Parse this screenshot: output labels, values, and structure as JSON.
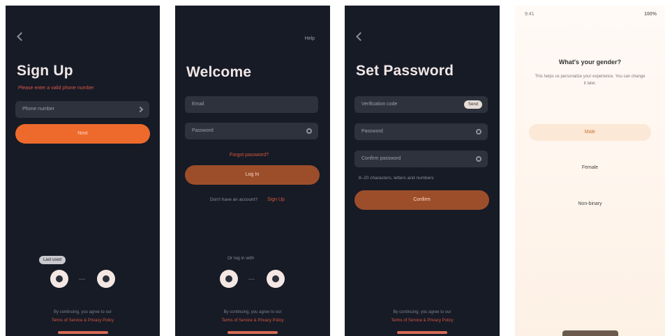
{
  "signup": {
    "title": "Sign Up",
    "error": "Please enter a valid phone number",
    "phone_placeholder": "Phone number",
    "button": "Next",
    "tooltip": "Last used",
    "footer_text": "By continuing, you agree to our",
    "footer_links": "Terms of Service & Privacy Policy"
  },
  "welcome": {
    "top_right": "Help",
    "title": "Welcome",
    "email_placeholder": "Email",
    "password_placeholder": "Password",
    "forgot": "Forgot password?",
    "button": "Log In",
    "signup_prompt": "Don't have an account?",
    "signup_link": "Sign Up",
    "alt_login": "Or log in with",
    "footer_text": "By continuing, you agree to our",
    "footer_links": "Terms of Service & Privacy Policy"
  },
  "setpassword": {
    "title": "Set Password",
    "code_placeholder": "Verification code",
    "send_chip": "Send",
    "password_placeholder": "Password",
    "confirm_placeholder": "Confirm password",
    "hint": "8–20 characters, letters and numbers",
    "button": "Confirm",
    "footer_text": "By continuing, you agree to our",
    "footer_links": "Terms of Service & Privacy Policy"
  },
  "gender": {
    "status_time": "9:41",
    "status_right": "100%",
    "question": "What's your gender?",
    "description": "This helps us personalize your experience. You can change it later.",
    "options": [
      "Male",
      "Female",
      "Non-binary"
    ]
  }
}
